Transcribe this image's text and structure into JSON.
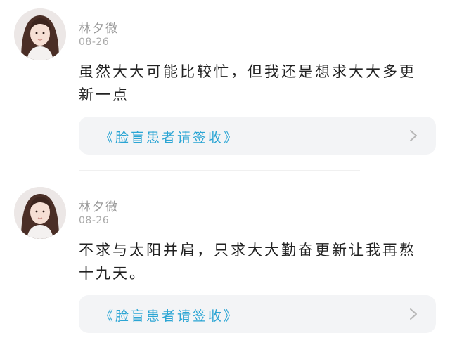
{
  "comments": [
    {
      "username": "林夕微",
      "date": "08-26",
      "content": "虽然大大可能比较忙，但我还是想求大大多更新一点",
      "quote": "《脸盲患者请签收》",
      "avatar_icon": "user-avatar-girl",
      "chevron_icon": "chevron-right-icon"
    },
    {
      "username": "林夕微",
      "date": "08-26",
      "content": "不求与太阳并肩，只求大大勤奋更新让我再熬十九天。",
      "quote": "《脸盲患者请签收》",
      "avatar_icon": "user-avatar-girl",
      "chevron_icon": "chevron-right-icon"
    }
  ],
  "colors": {
    "quote_link": "#2ba5d4",
    "card_bg": "#f3f4f6",
    "meta_text": "#9a9a9a",
    "body_text": "#222222"
  }
}
